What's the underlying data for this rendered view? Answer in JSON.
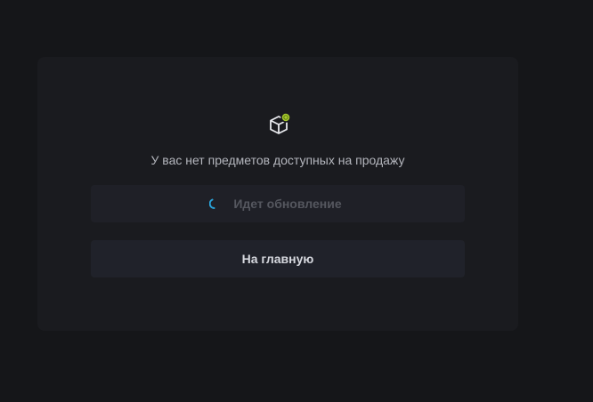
{
  "empty_state": {
    "icon": "box-icon",
    "badge_icon": "coin-icon",
    "badge_color": "#a6c92d",
    "message": "У вас нет предметов доступных на продажу"
  },
  "refresh_button": {
    "label": "Идет обновление",
    "spinner_color": "#2aa3d9",
    "disabled": true
  },
  "home_button": {
    "label": "На главную"
  }
}
